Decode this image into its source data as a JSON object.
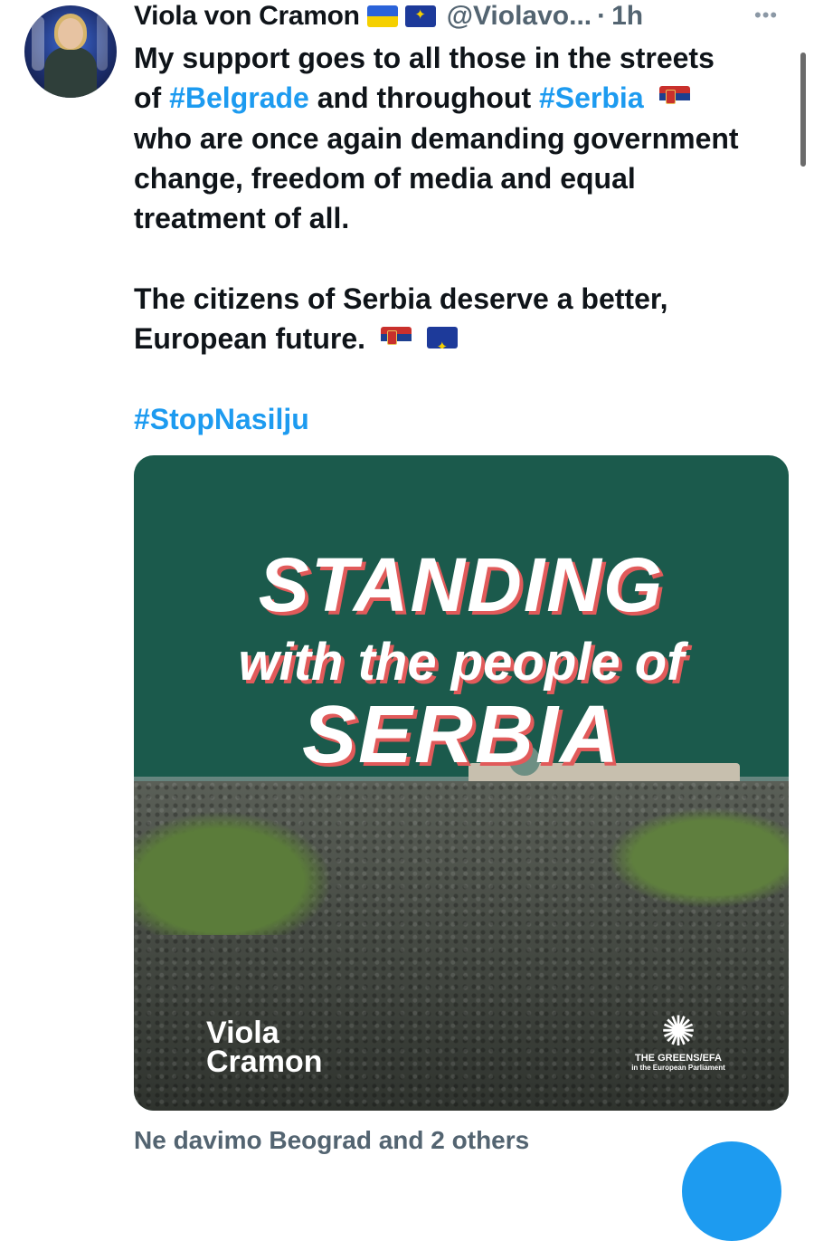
{
  "tweet": {
    "author_name": "Viola von Cramon",
    "handle": "@Violavo...",
    "separator": "·",
    "time": "1h",
    "more": "•••",
    "lines": [
      "My support goes to all those in the streets",
      "of",
      "#Belgrade",
      "and throughout",
      "#Serbia",
      "who are once again demanding government",
      "change, freedom of media and equal",
      "treatment of all.",
      "The citizens of Serbia deserve a better,",
      "European future.",
      "#StopNasilju"
    ]
  },
  "media": {
    "title_1": "STANDING",
    "title_2": "with the people of",
    "title_3": "SERBIA",
    "logo_left_line1": "Viola",
    "logo_left_line2": "Cramon",
    "logo_right_mark": "✺",
    "logo_right_text": "THE GREENS/EFA",
    "logo_right_sub": "in the European Parliament"
  },
  "footer": {
    "liked_by": "Ne davimo Beograd and 2 others"
  },
  "icons": {
    "flag_1": "ukraine-flag-icon",
    "flag_2": "eu-flag-icon",
    "flag_3": "serbia-flag-icon"
  },
  "colors": {
    "hashtag": "#1d9bf0",
    "media_background": "#1b5a4c",
    "title_shadow": "#e15a5a",
    "fab": "#1d9bf0"
  }
}
